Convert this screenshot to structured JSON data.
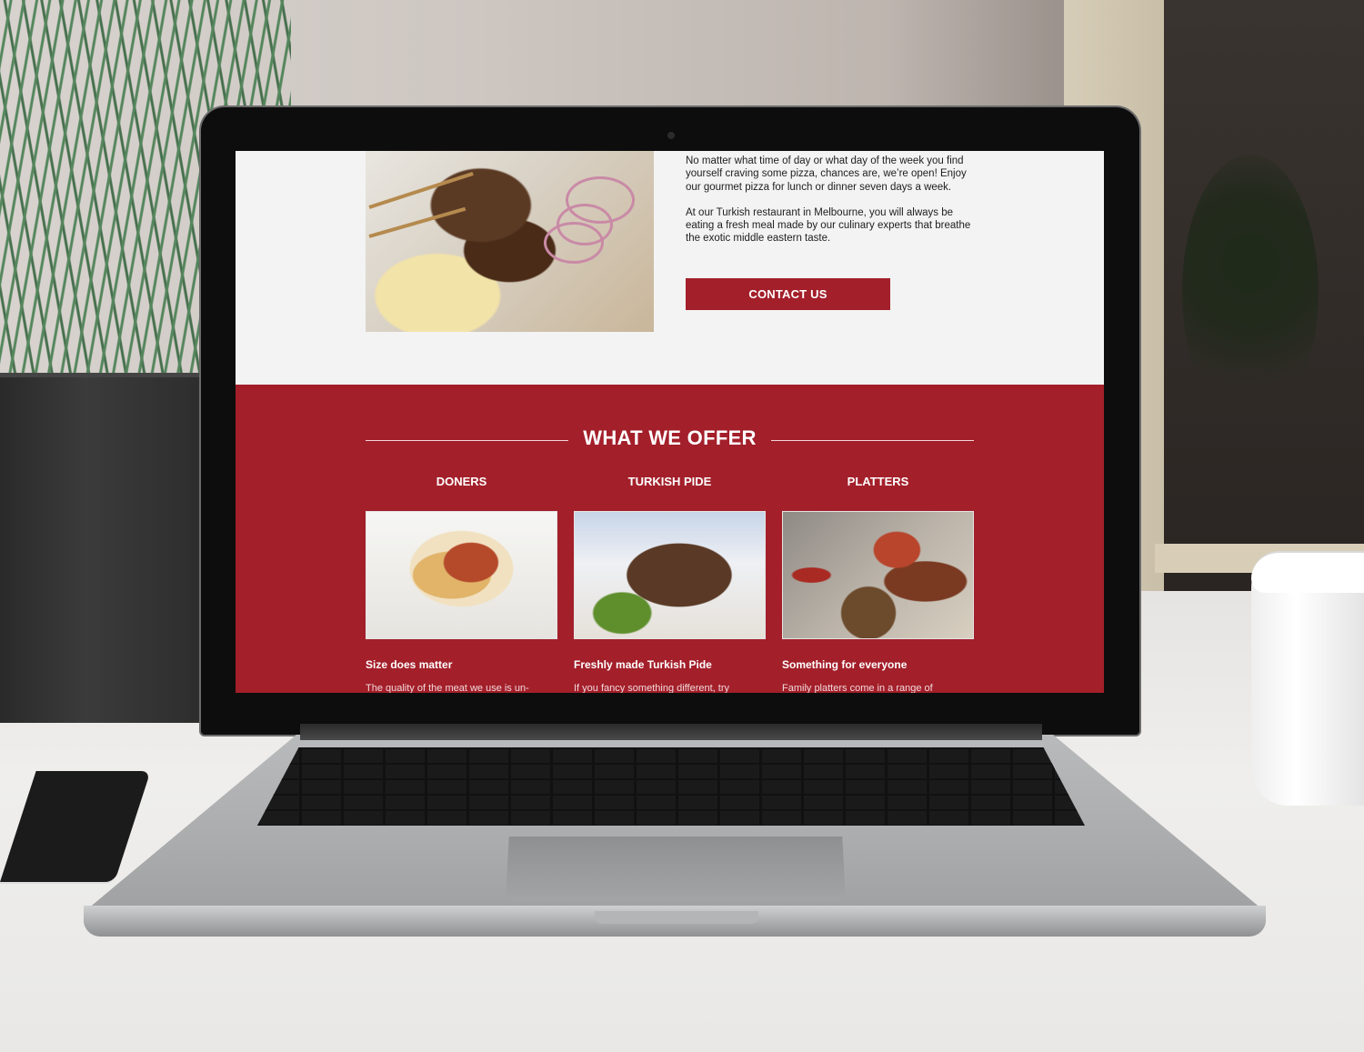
{
  "intro": {
    "paragraph_1": "No matter what time of day or what day of the week you find yourself craving some pizza, chances are, we’re open! Enjoy our gourmet pizza for lunch or dinner seven days a week.",
    "paragraph_2": "At our Turkish restaurant in Melbourne, you will always be eating a fresh meal made by our culinary experts that breathe the exotic middle eastern taste.",
    "contact_label": "CONTACT US"
  },
  "offer": {
    "title": "WHAT WE OFFER",
    "items": [
      {
        "title": "DONERS",
        "subtitle": "Size does matter",
        "description": "The quality of the meat we use is un-"
      },
      {
        "title": "TURKISH PIDE",
        "subtitle": "Freshly made Turkish Pide",
        "description": "If you fancy something different, try"
      },
      {
        "title": "PLATTERS",
        "subtitle": "Something for everyone",
        "description": "Family platters come in a range of"
      }
    ]
  },
  "colors": {
    "brand_red": "#a31f2a",
    "page_bg": "#f3f3f3"
  }
}
